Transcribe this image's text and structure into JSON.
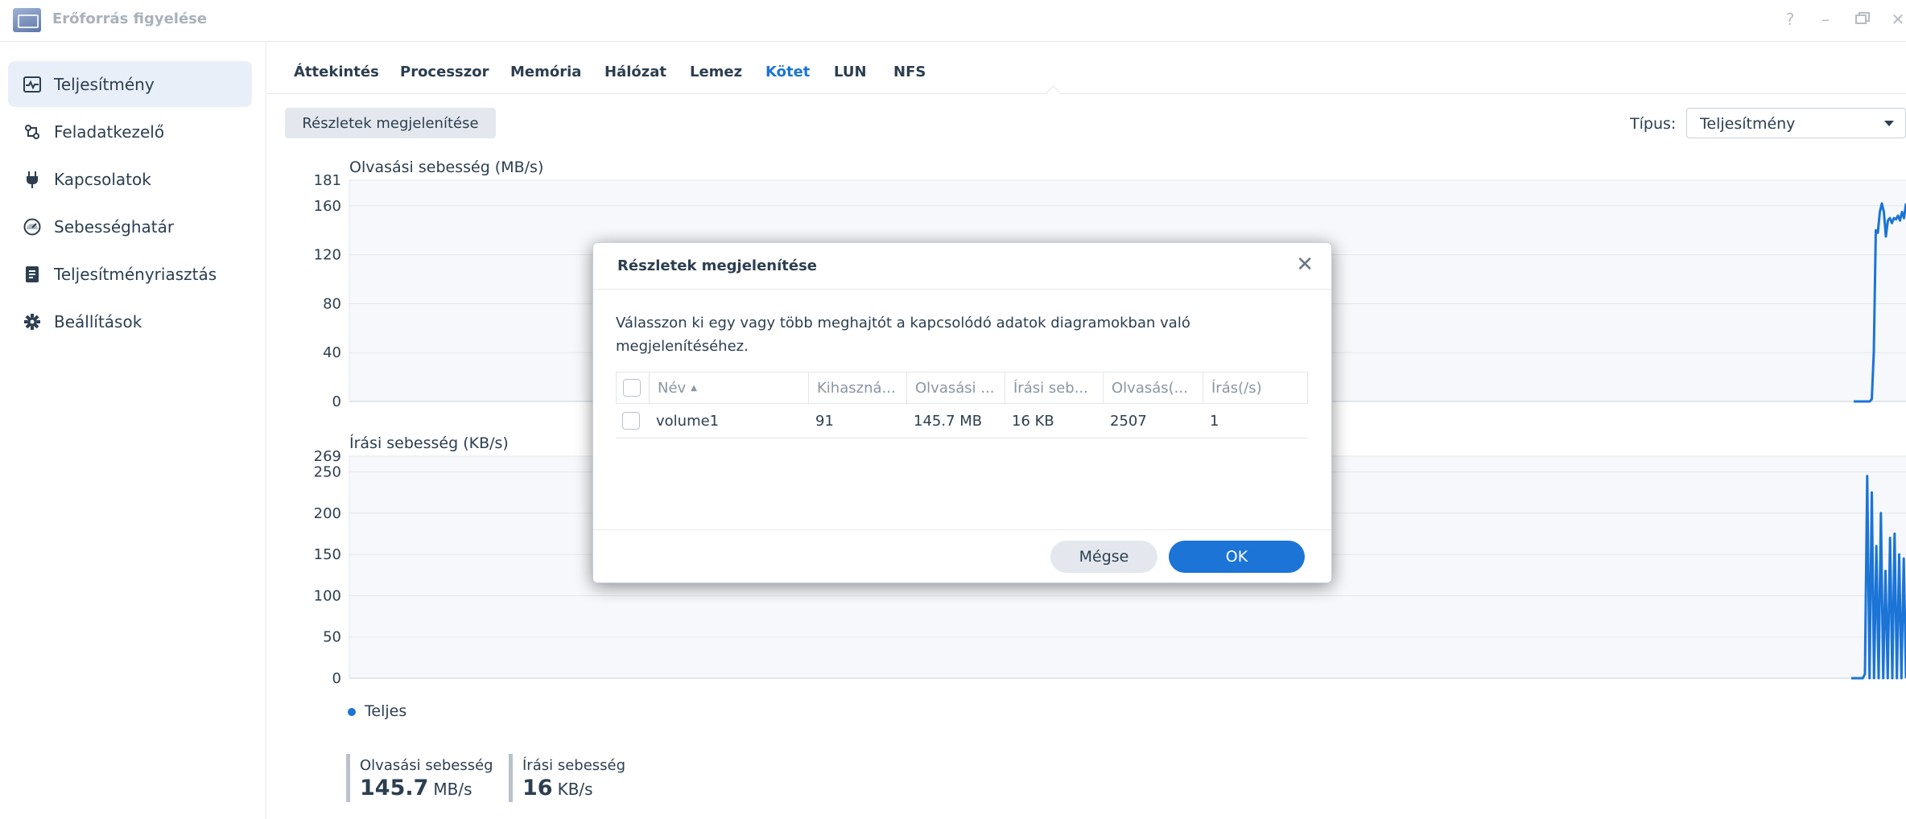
{
  "window": {
    "title": "Erőforrás figyelése",
    "controls": [
      "help-icon",
      "minimize-icon",
      "restore-icon",
      "close-icon"
    ]
  },
  "sidebar": {
    "items": [
      {
        "label": "Teljesítmény",
        "icon": "performance-chart-icon",
        "active": true
      },
      {
        "label": "Feladatkezelő",
        "icon": "task-manager-icon",
        "active": false
      },
      {
        "label": "Kapcsolatok",
        "icon": "plug-icon",
        "active": false
      },
      {
        "label": "Sebességhatár",
        "icon": "speedometer-icon",
        "active": false
      },
      {
        "label": "Teljesítményriasztás",
        "icon": "report-icon",
        "active": false
      },
      {
        "label": "Beállítások",
        "icon": "gear-icon",
        "active": false
      }
    ]
  },
  "tabs": [
    {
      "label": "Áttekintés",
      "active": false
    },
    {
      "label": "Processzor",
      "active": false
    },
    {
      "label": "Memória",
      "active": false
    },
    {
      "label": "Hálózat",
      "active": false
    },
    {
      "label": "Lemez",
      "active": false
    },
    {
      "label": "Kötet",
      "active": true
    },
    {
      "label": "LUN",
      "active": false
    },
    {
      "label": "NFS",
      "active": false
    }
  ],
  "toolbar": {
    "details_button": "Részletek megjelenítése",
    "type_label": "Típus:",
    "type_value": "Teljesítmény"
  },
  "colors": {
    "accent": "#1b74d6",
    "sidebar_active": "#e9eff9",
    "plot_bg": "#f6f8fb"
  },
  "chart_data": [
    {
      "type": "line",
      "title": "Olvasási sebesség (MB/s)",
      "yticks": [
        "181",
        "160",
        "120",
        "80",
        "40",
        "0"
      ],
      "ylim": [
        0,
        181
      ],
      "grid": true,
      "series": [
        {
          "name": "Teljes",
          "values": [
            0,
            0,
            0,
            0,
            0,
            0,
            0,
            0,
            0,
            2,
            40,
            140,
            138,
            155,
            162,
            155,
            135,
            148,
            150,
            146,
            150,
            149,
            152,
            148,
            155,
            150,
            162
          ]
        }
      ]
    },
    {
      "type": "line",
      "title": "Írási sebesség (KB/s)",
      "yticks": [
        "269",
        "250",
        "200",
        "150",
        "100",
        "50",
        "0"
      ],
      "ylim": [
        0,
        269
      ],
      "grid": true,
      "series": [
        {
          "name": "Teljes",
          "values": [
            0,
            0,
            0,
            0,
            0,
            0,
            5,
            245,
            0,
            225,
            0,
            160,
            0,
            200,
            0,
            130,
            0,
            170,
            0,
            175,
            0,
            150,
            0,
            145,
            0
          ]
        }
      ]
    }
  ],
  "legend": {
    "label": "Teljes"
  },
  "stats": [
    {
      "label": "Olvasási sebesség",
      "value": "145.7",
      "unit": "MB/s"
    },
    {
      "label": "Írási sebesség",
      "value": "16",
      "unit": "KB/s"
    }
  ],
  "dialog": {
    "title": "Részletek megjelenítése",
    "description": "Válasszon ki egy vagy több meghajtót a kapcsolódó adatok diagramokban való megjelenítéséhez.",
    "columns": [
      "Név",
      "Kihaszná...",
      "Olvasási ...",
      "Írási seb...",
      "Olvasás(...",
      "Írás(/s)"
    ],
    "sort_indicator": "▲",
    "rows": [
      {
        "name": "volume1",
        "utilization": "91",
        "read_speed": "145.7 MB",
        "write_speed": "16 KB",
        "reads": "2507",
        "writes": "1"
      }
    ],
    "cancel_label": "Mégse",
    "ok_label": "OK"
  }
}
